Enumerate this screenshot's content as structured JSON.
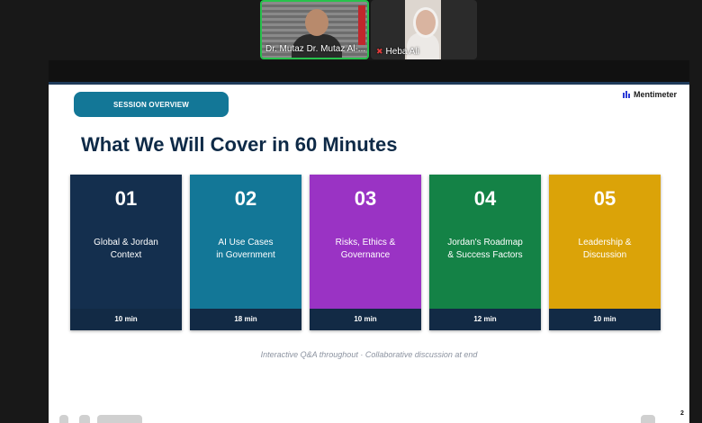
{
  "participants": [
    {
      "name": "Dr. Mutaz Dr. Mutaz Al-..."
    },
    {
      "name": "Heba Ali",
      "mic_muted": true
    }
  ],
  "slide": {
    "pill_label": "SESSION OVERVIEW",
    "brand": "Mentimeter",
    "title": "What We Will Cover in 60 Minutes",
    "cards": [
      {
        "number": "01",
        "line1": "Global & Jordan",
        "line2": "Context",
        "duration": "10 min",
        "color": "#142f4e"
      },
      {
        "number": "02",
        "line1": "AI Use Cases",
        "line2": "in Government",
        "duration": "18 min",
        "color": "#137797"
      },
      {
        "number": "03",
        "line1": "Risks, Ethics &",
        "line2": "Governance",
        "duration": "10 min",
        "color": "#9a33c4"
      },
      {
        "number": "04",
        "line1": "Jordan's Roadmap",
        "line2": "& Success Factors",
        "duration": "12 min",
        "color": "#148246"
      },
      {
        "number": "05",
        "line1": "Leadership &",
        "line2": "Discussion",
        "duration": "10 min",
        "color": "#dba308"
      }
    ],
    "footnote": "Interactive Q&A throughout  ·  Collaborative discussion at end"
  },
  "corner_badge": "2"
}
